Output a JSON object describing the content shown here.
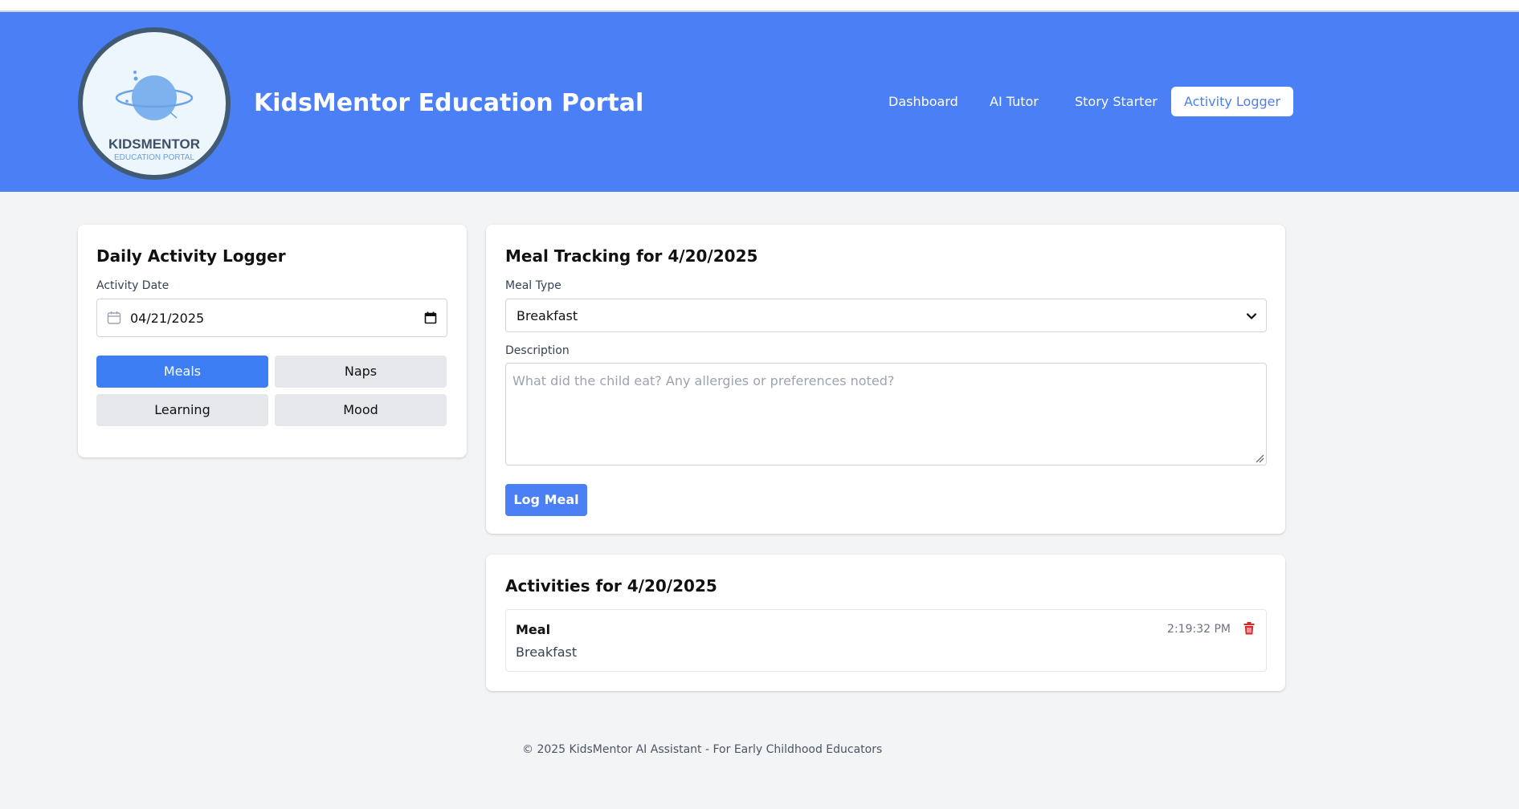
{
  "header": {
    "logo": {
      "title": "KIDSMENTOR",
      "subtitle": "EDUCATION PORTAL"
    },
    "site_title": "KidsMentor Education Portal",
    "nav": [
      {
        "label": "Dashboard",
        "active": false
      },
      {
        "label": "AI Tutor",
        "active": false
      },
      {
        "label": "Story Starter",
        "active": false
      },
      {
        "label": "Activity Logger",
        "active": true
      }
    ],
    "color": "#4a7ff5"
  },
  "logger": {
    "title": "Daily Activity Logger",
    "date_label": "Activity Date",
    "date_value": "04/21/2025",
    "tabs": [
      {
        "label": "Meals",
        "active": true
      },
      {
        "label": "Naps",
        "active": false
      },
      {
        "label": "Learning",
        "active": false
      },
      {
        "label": "Mood",
        "active": false
      }
    ]
  },
  "meal_form": {
    "title": "Meal Tracking for 4/20/2025",
    "meal_type_label": "Meal Type",
    "meal_type_value": "Breakfast",
    "description_label": "Description",
    "description_placeholder": "What did the child eat? Any allergies or preferences noted?",
    "submit_label": "Log Meal"
  },
  "activities": {
    "title": "Activities for 4/20/2025",
    "items": [
      {
        "type": "Meal",
        "description": "Breakfast",
        "time": "2:19:32 PM"
      }
    ]
  },
  "footer": {
    "text": "© 2025 KidsMentor AI Assistant - For Early Childhood Educators"
  },
  "icons": [
    "calendar-icon",
    "chevron-down-icon",
    "trash-icon",
    "resize-grip-icon"
  ]
}
